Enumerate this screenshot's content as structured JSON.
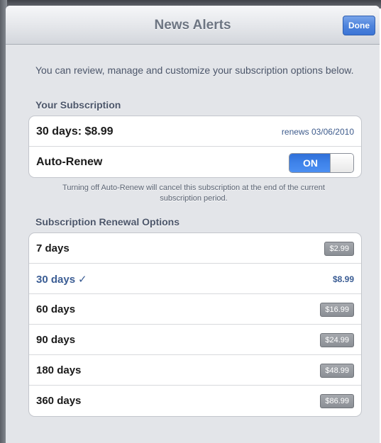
{
  "nav": {
    "title": "News Alerts",
    "done_label": "Done"
  },
  "intro_text": "You can review, manage and customize your subscription options below.",
  "subscription": {
    "header": "Your Subscription",
    "plan_label": "30 days: $8.99",
    "renews_text": "renews 03/06/2010",
    "auto_renew_label": "Auto-Renew",
    "auto_renew_state": "ON",
    "footnote": "Turning off Auto-Renew will cancel this subscription at the end of the current subscription period."
  },
  "renewal": {
    "header": "Subscription Renewal Options",
    "options": [
      {
        "label": "7 days",
        "price": "$2.99",
        "selected": false
      },
      {
        "label": "30 days",
        "price": "$8.99",
        "selected": true
      },
      {
        "label": "60 days",
        "price": "$16.99",
        "selected": false
      },
      {
        "label": "90 days",
        "price": "$24.99",
        "selected": false
      },
      {
        "label": "180 days",
        "price": "$48.99",
        "selected": false
      },
      {
        "label": "360 days",
        "price": "$86.99",
        "selected": false
      }
    ]
  },
  "colors": {
    "accent": "#3b5d94",
    "toggle_on": "#3f83ea",
    "done_button": "#4f84dc"
  },
  "icons": {
    "selected_mark": "checkmark-icon"
  }
}
